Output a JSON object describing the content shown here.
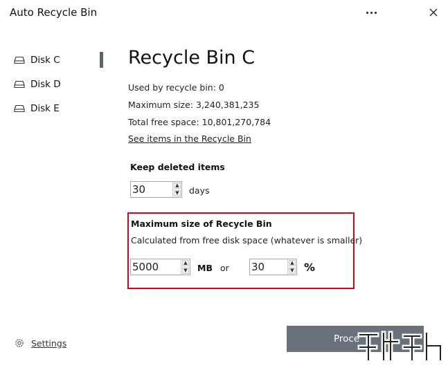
{
  "window": {
    "title": "Auto Recycle Bin"
  },
  "sidebar": {
    "disks": [
      {
        "label": "Disk C",
        "selected": true
      },
      {
        "label": "Disk D",
        "selected": false
      },
      {
        "label": "Disk E",
        "selected": false
      }
    ],
    "settings_label": "Settings"
  },
  "main": {
    "title": "Recycle Bin C",
    "used_label": "Used by recycle bin: 0",
    "max_size_label": "Maximum size: 3,240,381,235",
    "free_space_label": "Total free space: 10,801,270,784",
    "see_items_link": "See items in the Recycle Bin",
    "keep": {
      "heading": "Keep deleted items",
      "value": "30",
      "unit": "days"
    },
    "max_size": {
      "heading": "Maximum size of Recycle Bin",
      "description": "Calculated from free disk space (whatever is smaller)",
      "mb_value": "5000",
      "mb_unit": "MB",
      "or_label": "or",
      "percent_value": "30",
      "percent_unit": "%"
    },
    "process_button": "Proce"
  },
  "colors": {
    "highlight_border": "#d9001b",
    "button_bg": "#69727a",
    "selection_bar": "#5a646a"
  }
}
